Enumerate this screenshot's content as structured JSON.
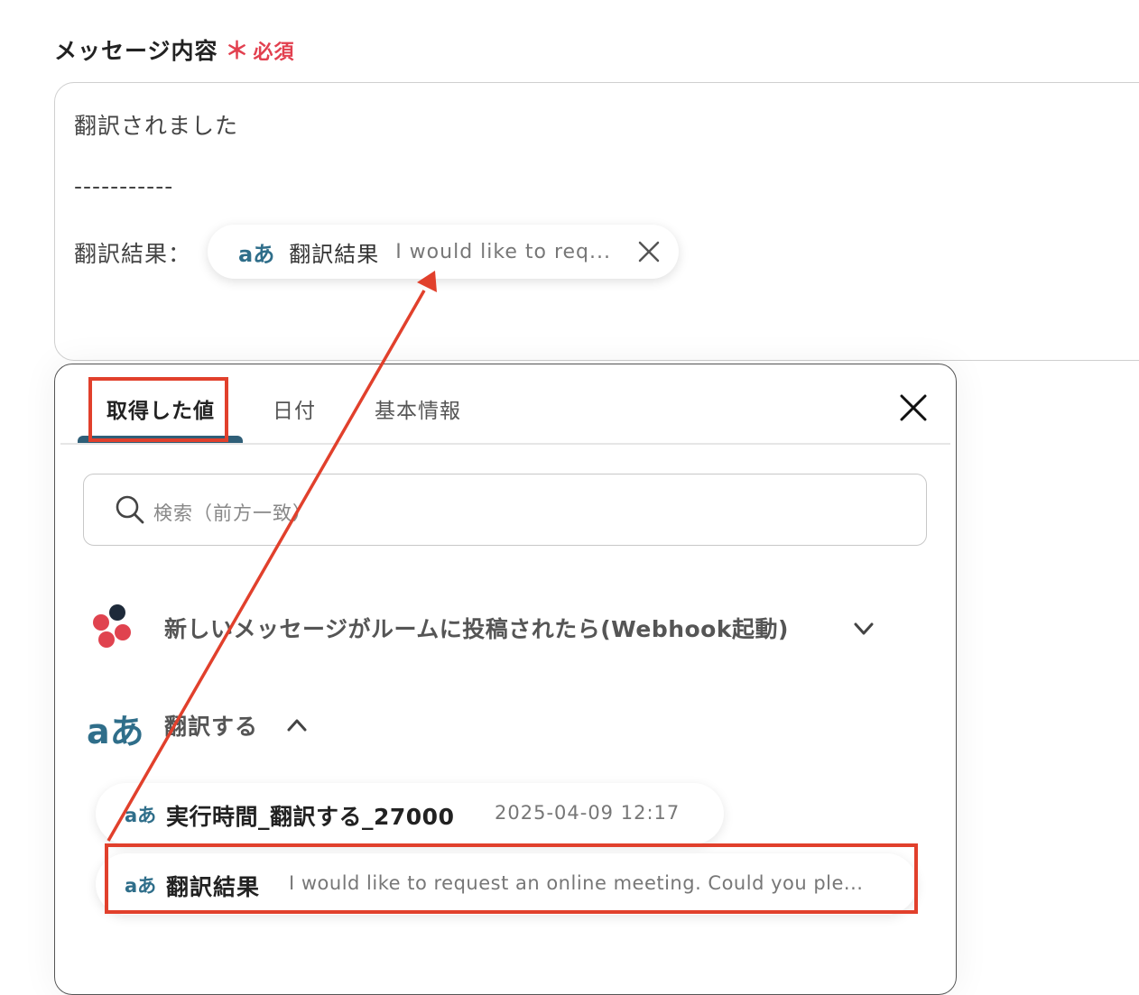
{
  "field": {
    "label": "メッセージ内容",
    "required_star": "＊",
    "required_text": "必須"
  },
  "editor": {
    "line1": "翻訳されました",
    "line2": "-----------",
    "line3_label": "翻訳結果：",
    "chip": {
      "icon": "aあ",
      "name": "翻訳結果",
      "value": "I would like to req..."
    }
  },
  "panel": {
    "tabs": [
      {
        "label": "取得した値",
        "active": true
      },
      {
        "label": "日付",
        "active": false
      },
      {
        "label": "基本情報",
        "active": false
      }
    ],
    "search_placeholder": "検索（前方一致）",
    "groups": [
      {
        "label": "新しいメッセージがルームに投稿されたら(Webhook起動)",
        "expanded": false
      },
      {
        "label": "翻訳する",
        "icon": "aあ",
        "expanded": true
      }
    ],
    "items": [
      {
        "icon": "aあ",
        "name": "実行時間_翻訳する_27000",
        "value": "2025-04-09 12:17"
      },
      {
        "icon": "aあ",
        "name": "翻訳結果",
        "value": "I would like to request an online meeting. Could you ple..."
      }
    ]
  },
  "colors": {
    "highlight": "#e1402c",
    "required": "#e2404f",
    "accent": "#2f5f78",
    "icon": "#2f6e8a"
  }
}
